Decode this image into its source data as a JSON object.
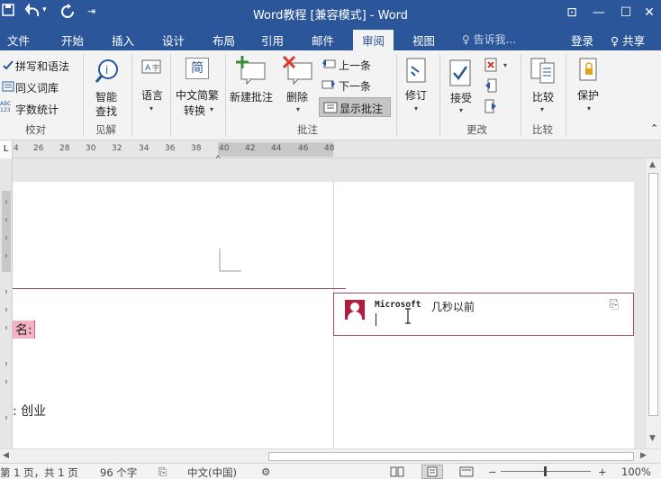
{
  "title_bar": {
    "title": "Word教程 [兼容模式] - Word",
    "save_icon": "save-icon",
    "undo_icon": "undo-icon",
    "undo_caret": "▾",
    "redo_icon": "redo-icon",
    "customize_glyph": "⇥",
    "restore_ribbon_glyph": "⊡",
    "minimize_glyph": "—",
    "maximize_glyph": "☐",
    "close_glyph": "✕"
  },
  "ribbon_tabs": [
    {
      "label": "文件"
    },
    {
      "label": "开始"
    },
    {
      "label": "插入"
    },
    {
      "label": "设计"
    },
    {
      "label": "布局"
    },
    {
      "label": "引用"
    },
    {
      "label": "邮件"
    },
    {
      "label": "审阅"
    },
    {
      "label": "视图"
    }
  ],
  "tell_me": "♀ 告诉我...",
  "login": "登录",
  "share": "♀ 共享",
  "proofing": {
    "spelling": "拼写和语法",
    "thesaurus": "同义词库",
    "word_count": "字数统计",
    "abc_glyph": "ABC 123",
    "group_label": "校对"
  },
  "insights": {
    "smart_lookup_line1": "智能",
    "smart_lookup_line2": "查找",
    "group_label": "见解"
  },
  "language": {
    "label": "语言",
    "caret": "▾"
  },
  "chinese_conversion": {
    "line1": "中文简繁",
    "line2": "转换",
    "caret": "▾",
    "icon_glyph": "简"
  },
  "comments": {
    "new_comment": "新建批注",
    "delete": "删除",
    "delete_caret": "▾",
    "previous": "上一条",
    "next": "下一条",
    "show_comments": "显示批注",
    "group_label": "批注"
  },
  "tracking": {
    "label": "修订",
    "caret": "▾"
  },
  "changes": {
    "accept": "接受",
    "accept_caret": "▾",
    "reject_caret": "▾",
    "group_label": "更改"
  },
  "compare": {
    "label": "比较",
    "caret": "▾",
    "group_label": "比较"
  },
  "protect": {
    "label": "保护",
    "caret": "▾"
  },
  "ribbon_collapse_glyph": "⌃",
  "ruler": {
    "corner_glyph": "L",
    "ticks": [
      "4",
      "26",
      "28",
      "30",
      "32",
      "34",
      "36",
      "38",
      "40",
      "42",
      "44",
      "46",
      "48"
    ]
  },
  "document": {
    "text_line1": "名:",
    "text_line2": ": 创业"
  },
  "comment": {
    "author": "Microsoft",
    "time": "几秒以前",
    "reply_glyph": "⎘"
  },
  "scrollbars": {
    "up_arrow": "▲",
    "down_arrow": "▼",
    "left_arrow": "◀",
    "right_arrow": "▶"
  },
  "status_bar": {
    "page": "第 1 页，共 1 页",
    "words": "96 个字",
    "proof_glyph": "⎘",
    "language": "中文(中国)",
    "macro_glyph": "⚙",
    "zoom_minus": "−",
    "zoom_plus": "+",
    "zoom": "100%"
  },
  "colors": {
    "word_blue": "#2b579a",
    "comment_border": "#9e4a6a",
    "avatar_red": "#b31c3b",
    "text_highlight": "#f4b3c2"
  }
}
